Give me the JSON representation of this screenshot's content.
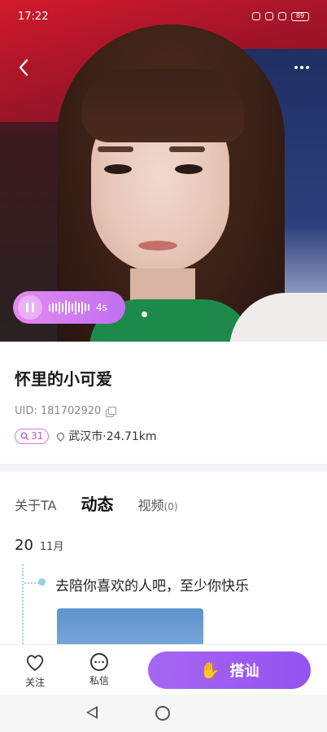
{
  "status_bar": {
    "time": "17:22",
    "battery": "89"
  },
  "voice": {
    "duration": "4s",
    "wave_levels": [
      0.35,
      0.6,
      0.45,
      0.8,
      0.5,
      1.0,
      0.7,
      0.4,
      0.9,
      0.55,
      0.75,
      0.45,
      0.3
    ]
  },
  "profile": {
    "name": "怀里的小可爱",
    "uid": "UID: 181702920",
    "badge_count": "31",
    "location": "武汉市·24.71km"
  },
  "tabs": [
    {
      "label": "关于TA",
      "count": ""
    },
    {
      "label": "动态",
      "count": ""
    },
    {
      "label": "视频",
      "count": "(0)"
    }
  ],
  "feed": {
    "date_day": "20",
    "date_month": "11月",
    "post_text": "去陪你喜欢的人吧，至少你快乐"
  },
  "actions": {
    "follow_label": "关注",
    "message_label": "私信",
    "chat_label": "搭讪"
  },
  "colors": {
    "accent": "#9a58f0",
    "voice_pill": "#d47cf0",
    "badge": "#c15bc1"
  }
}
